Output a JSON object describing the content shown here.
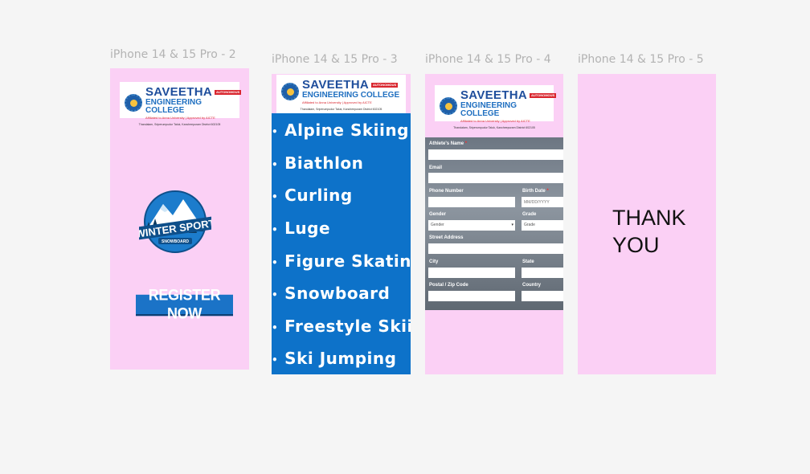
{
  "frames": [
    {
      "label": "iPhone 14 & 15 Pro - 2"
    },
    {
      "label": "iPhone 14 & 15 Pro - 3"
    },
    {
      "label": "iPhone 14 & 15 Pro - 4"
    },
    {
      "label": "iPhone 14 & 15 Pro - 5"
    }
  ],
  "college": {
    "name": "SAVEETHA",
    "autonomous": "AUTONOMOUS",
    "subtitle": "ENGINEERING COLLEGE",
    "affiliation": "Affiliated to Anna University | Approved by AICTE",
    "address": "Thandalam, Sriperumpudur Taluk, Kancheepuram District 602105"
  },
  "badge": {
    "title": "WINTER SPORT",
    "ribbon": "SNOWBOARD"
  },
  "register_label": "REGISTER NOW",
  "sports": [
    "Alpine Skiing",
    "Biathlon",
    "Curling",
    "Luge",
    "Figure Skating",
    "Snowboard",
    "Freestyle Skiing",
    "Ski Jumping"
  ],
  "form": {
    "athlete_name": "Athlete's Name",
    "email": "Email",
    "phone": "Phone Number",
    "birth_date": "Birth Date",
    "birth_placeholder": "MM/DD/YYYY",
    "gender": "Gender",
    "gender_value": "Gender",
    "grade": "Grade",
    "grade_value": "Grade",
    "street": "Street Address",
    "city": "City",
    "state": "State",
    "postal": "Postal / Zip Code",
    "country": "Country"
  },
  "thank_you": {
    "line1": "THANK",
    "line2": "YOU"
  },
  "colors": {
    "frame_bg": "#fbd0f5",
    "sports_bg": "#0d72c9",
    "brand_blue": "#1f4e9c",
    "accent_red": "#d9262e"
  }
}
